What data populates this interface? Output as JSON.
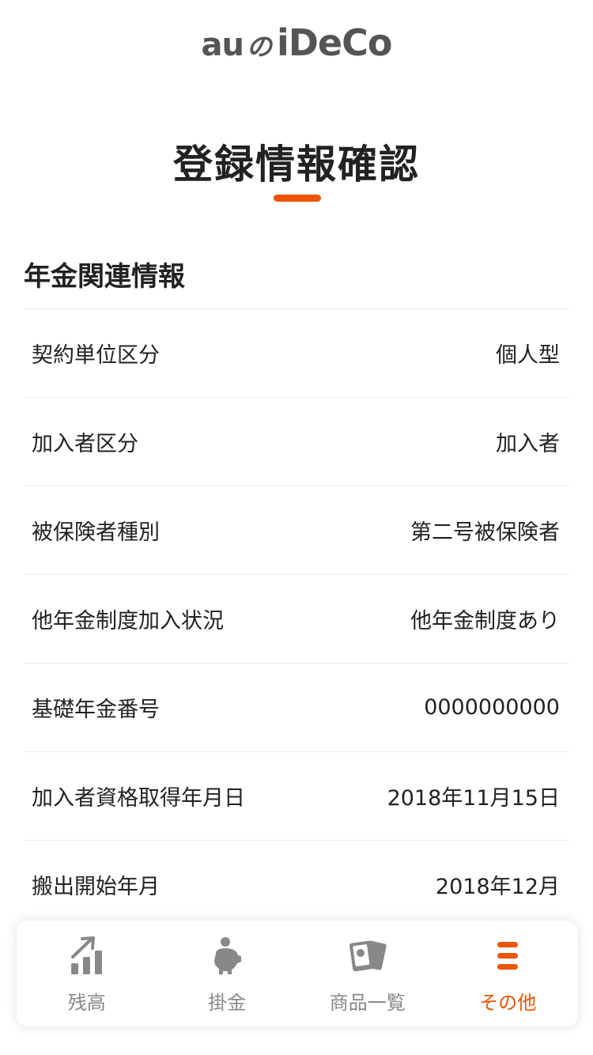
{
  "header": {
    "logo_au": "au",
    "logo_no": "の",
    "logo_ideco": "iDeCo"
  },
  "page": {
    "title": "登録情報確認",
    "accent_color": "#eb5505"
  },
  "section": {
    "title": "年金関連情報"
  },
  "rows": [
    {
      "label": "契約単位区分",
      "value": "個人型"
    },
    {
      "label": "加入者区分",
      "value": "加入者"
    },
    {
      "label": "被保険者種別",
      "value": "第二号被保険者"
    },
    {
      "label": "他年金制度加入状況",
      "value": "他年金制度あり"
    },
    {
      "label": "基礎年金番号",
      "value": "0000000000"
    },
    {
      "label": "加入者資格取得年月日",
      "value": "2018年11月15日"
    },
    {
      "label": "搬出開始年月",
      "value": "2018年12月"
    }
  ],
  "tabbar": {
    "items": [
      {
        "label": "残高",
        "icon": "bar-chart-up-icon",
        "active": false
      },
      {
        "label": "掛金",
        "icon": "piggy-bank-icon",
        "active": false
      },
      {
        "label": "商品一覧",
        "icon": "documents-icon",
        "active": false
      },
      {
        "label": "その他",
        "icon": "menu-icon",
        "active": true
      }
    ],
    "active_color": "#eb5505",
    "inactive_color": "#888888"
  }
}
